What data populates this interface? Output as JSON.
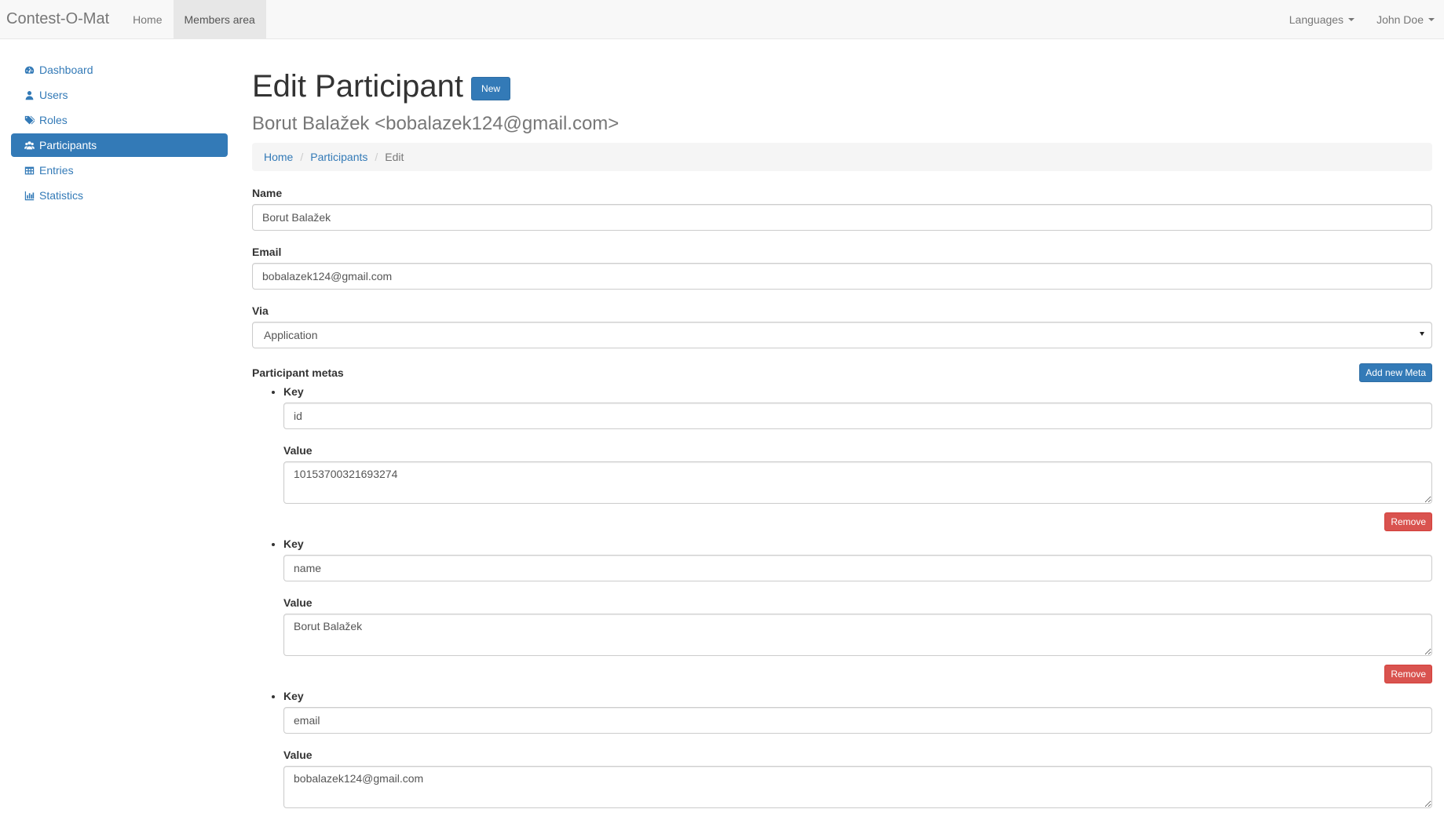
{
  "navbar": {
    "brand": "Contest-O-Mat",
    "links": [
      {
        "label": "Home"
      },
      {
        "label": "Members area"
      }
    ],
    "languages_label": "Languages",
    "user_label": "John Doe"
  },
  "sidebar": {
    "items": [
      {
        "label": "Dashboard",
        "icon": "dashboard-icon"
      },
      {
        "label": "Users",
        "icon": "user-icon"
      },
      {
        "label": "Roles",
        "icon": "tags-icon"
      },
      {
        "label": "Participants",
        "icon": "users-icon",
        "active": true
      },
      {
        "label": "Entries",
        "icon": "table-icon"
      },
      {
        "label": "Statistics",
        "icon": "stats-icon"
      }
    ]
  },
  "page": {
    "title": "Edit Participant",
    "new_button": "New",
    "subtitle": "Borut Balažek <bobalazek124@gmail.com>"
  },
  "breadcrumb": {
    "home": "Home",
    "participants": "Participants",
    "current": "Edit"
  },
  "form": {
    "name_label": "Name",
    "name_value": "Borut Balažek",
    "email_label": "Email",
    "email_value": "bobalazek124@gmail.com",
    "via_label": "Via",
    "via_value": "Application",
    "metas_label": "Participant metas",
    "add_meta_button": "Add new Meta",
    "key_label": "Key",
    "value_label": "Value",
    "remove_button": "Remove",
    "metas": [
      {
        "key": "id",
        "value": "10153700321693274"
      },
      {
        "key": "name",
        "value": "Borut Balažek"
      },
      {
        "key": "email",
        "value": "bobalazek124@gmail.com"
      }
    ]
  },
  "colors": {
    "primary": "#337ab7",
    "danger": "#d9534f",
    "navbar_bg": "#f8f8f8"
  }
}
